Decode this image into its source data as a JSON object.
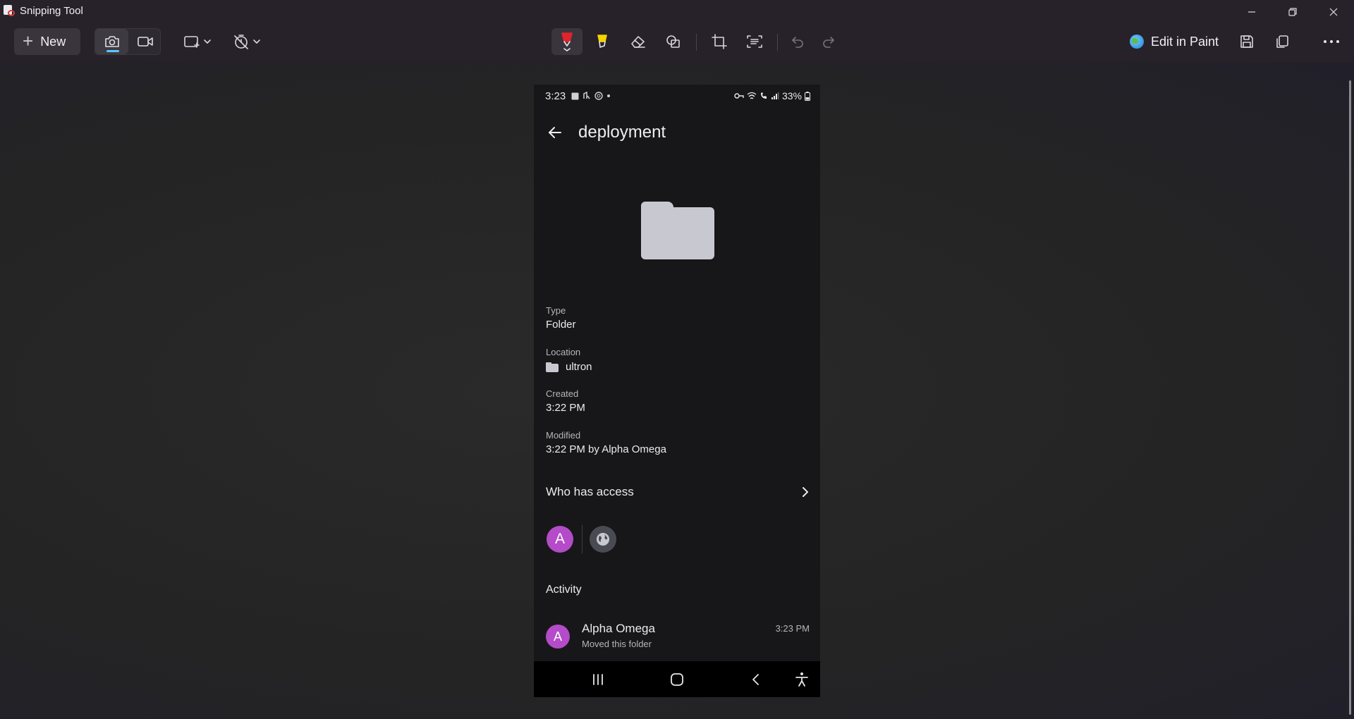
{
  "window": {
    "title": "Snipping Tool",
    "controls": [
      "minimize-icon",
      "restore-icon",
      "close-icon"
    ]
  },
  "toolbar": {
    "new_label": "New",
    "edit_in_paint_label": "Edit in Paint",
    "tools": [
      "camera-icon",
      "video-icon",
      "snip-mode-icon",
      "timer-off-icon",
      "pen-icon",
      "highlighter-icon",
      "eraser-icon",
      "shapes-icon",
      "crop-icon",
      "text-actions-icon",
      "undo-icon",
      "redo-icon",
      "save-icon",
      "copy-icon",
      "more-icon"
    ],
    "accent_color": "#5cc8ff",
    "pen_color": "#e0242b",
    "highlighter_color": "#f5d400"
  },
  "phone": {
    "status": {
      "time": "3:23",
      "battery": "33%"
    },
    "header": {
      "title": "deployment"
    },
    "details": {
      "type_label": "Type",
      "type_value": "Folder",
      "location_label": "Location",
      "location_value": "ultron",
      "created_label": "Created",
      "created_value": "3:22 PM",
      "modified_label": "Modified",
      "modified_value": "3:22 PM by Alpha Omega"
    },
    "access": {
      "title": "Who has access",
      "owner_initial": "A",
      "avatar_color": "#b44bc9"
    },
    "activity": {
      "title": "Activity",
      "items": [
        {
          "initial": "A",
          "name": "Alpha Omega",
          "description": "Moved this folder",
          "time": "3:23 PM"
        }
      ]
    },
    "nav": [
      "recents-icon",
      "home-icon",
      "back-icon",
      "accessibility-icon"
    ]
  }
}
